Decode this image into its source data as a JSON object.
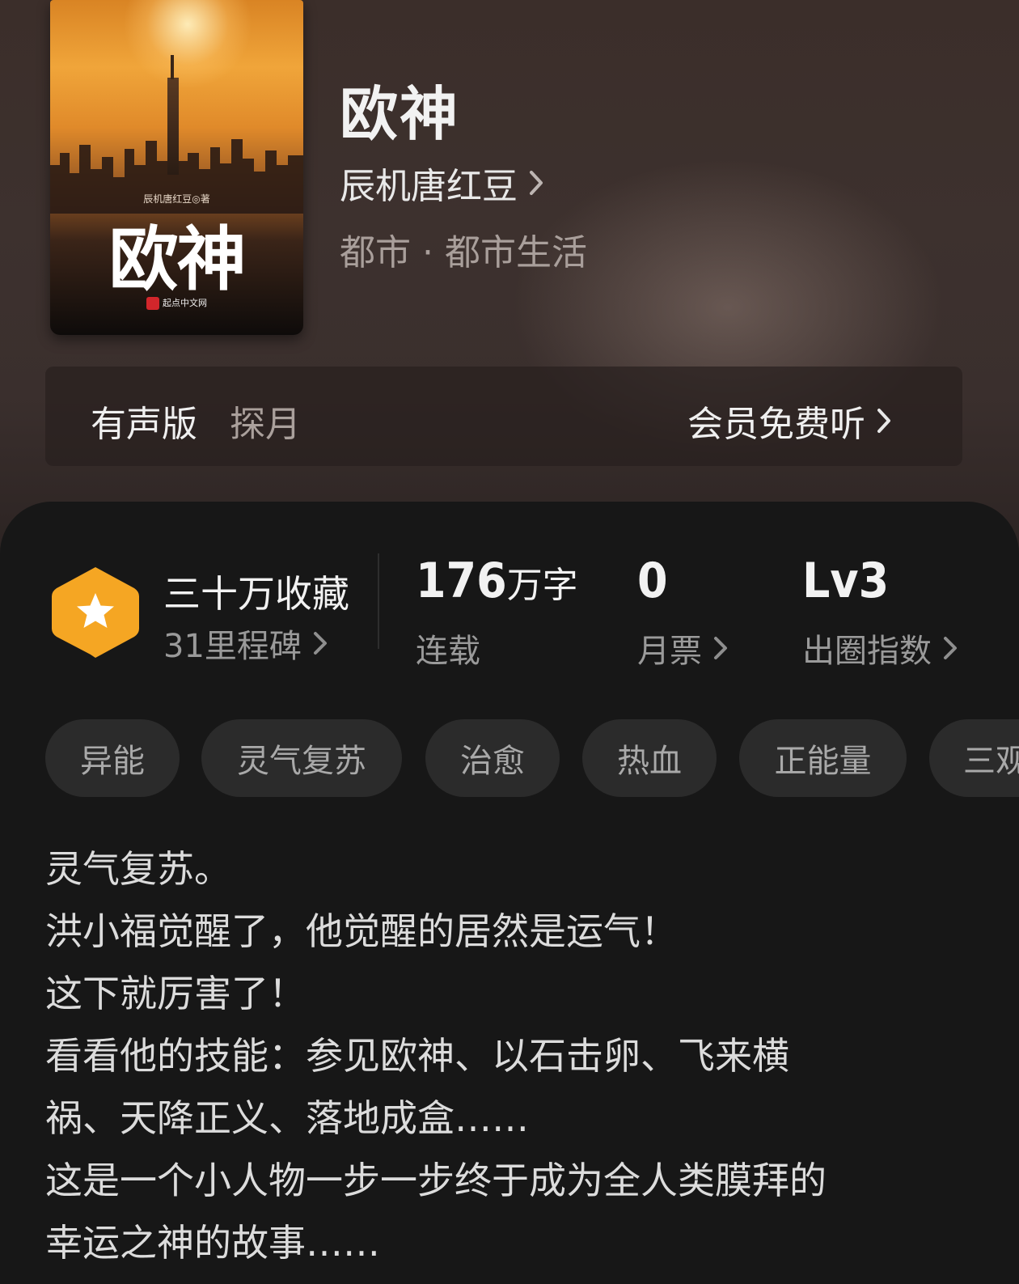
{
  "cover": {
    "author_line": "辰机唐红豆◎著",
    "title": "欧神",
    "publisher": "起点中文网"
  },
  "book": {
    "title": "欧神",
    "author": "辰机唐红豆",
    "genre": "都市 · 都市生活"
  },
  "audio": {
    "label": "有声版",
    "narrator": "探月",
    "cta": "会员免费听"
  },
  "stats": {
    "badge_icon": "star-hexagon-icon",
    "badge_color": "#F5A623",
    "collections": "三十万收藏",
    "milestones": "31里程碑",
    "word_count_number": "176",
    "word_count_unit": "万字",
    "status": "连载",
    "monthly_tickets": "0",
    "monthly_tickets_label": "月票",
    "level": "Lv3",
    "level_label": "出圈指数"
  },
  "tags": [
    "异能",
    "灵气复苏",
    "治愈",
    "热血",
    "正能量",
    "三观"
  ],
  "description": [
    "灵气复苏。",
    "洪小福觉醒了，他觉醒的居然是运气！",
    "这下就厉害了！",
    "看看他的技能：参见欧神、以石击卵、飞来横",
    "祸、天降正义、落地成盒……",
    "这是一个小人物一步一步终于成为全人类膜拜的",
    "幸运之神的故事……"
  ]
}
